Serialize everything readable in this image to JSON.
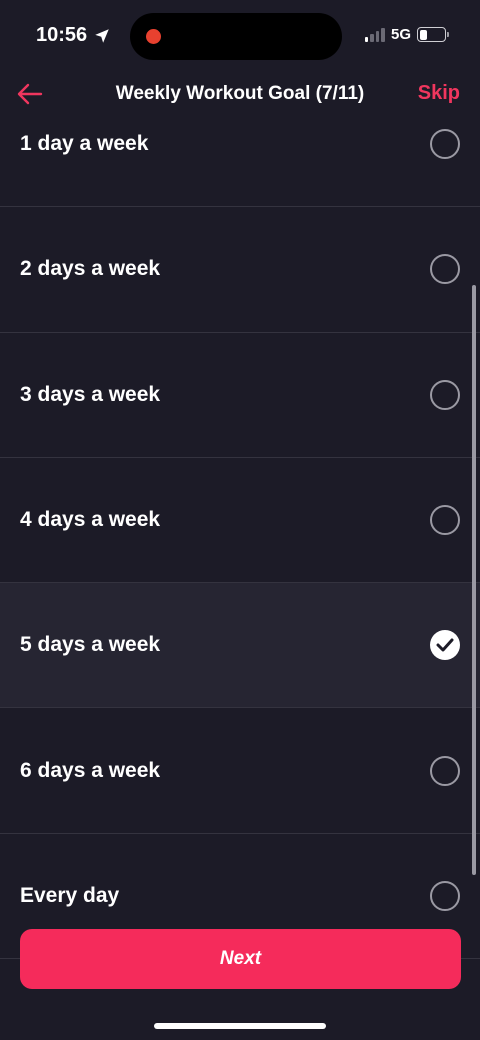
{
  "status_bar": {
    "time": "10:56",
    "network": "5G"
  },
  "header": {
    "title": "Weekly Workout Goal (7/11)",
    "skip_label": "Skip"
  },
  "options": [
    {
      "label": "1 day a week",
      "selected": false
    },
    {
      "label": "2 days a week",
      "selected": false
    },
    {
      "label": "3 days a week",
      "selected": false
    },
    {
      "label": "4 days a week",
      "selected": false
    },
    {
      "label": "5 days a week",
      "selected": true
    },
    {
      "label": "6 days a week",
      "selected": false
    },
    {
      "label": "Every day",
      "selected": false
    }
  ],
  "next_label": "Next",
  "colors": {
    "background": "#1c1b27",
    "selected_row": "#262532",
    "accent": "#f52b5b",
    "skip_text": "#f0365e"
  }
}
